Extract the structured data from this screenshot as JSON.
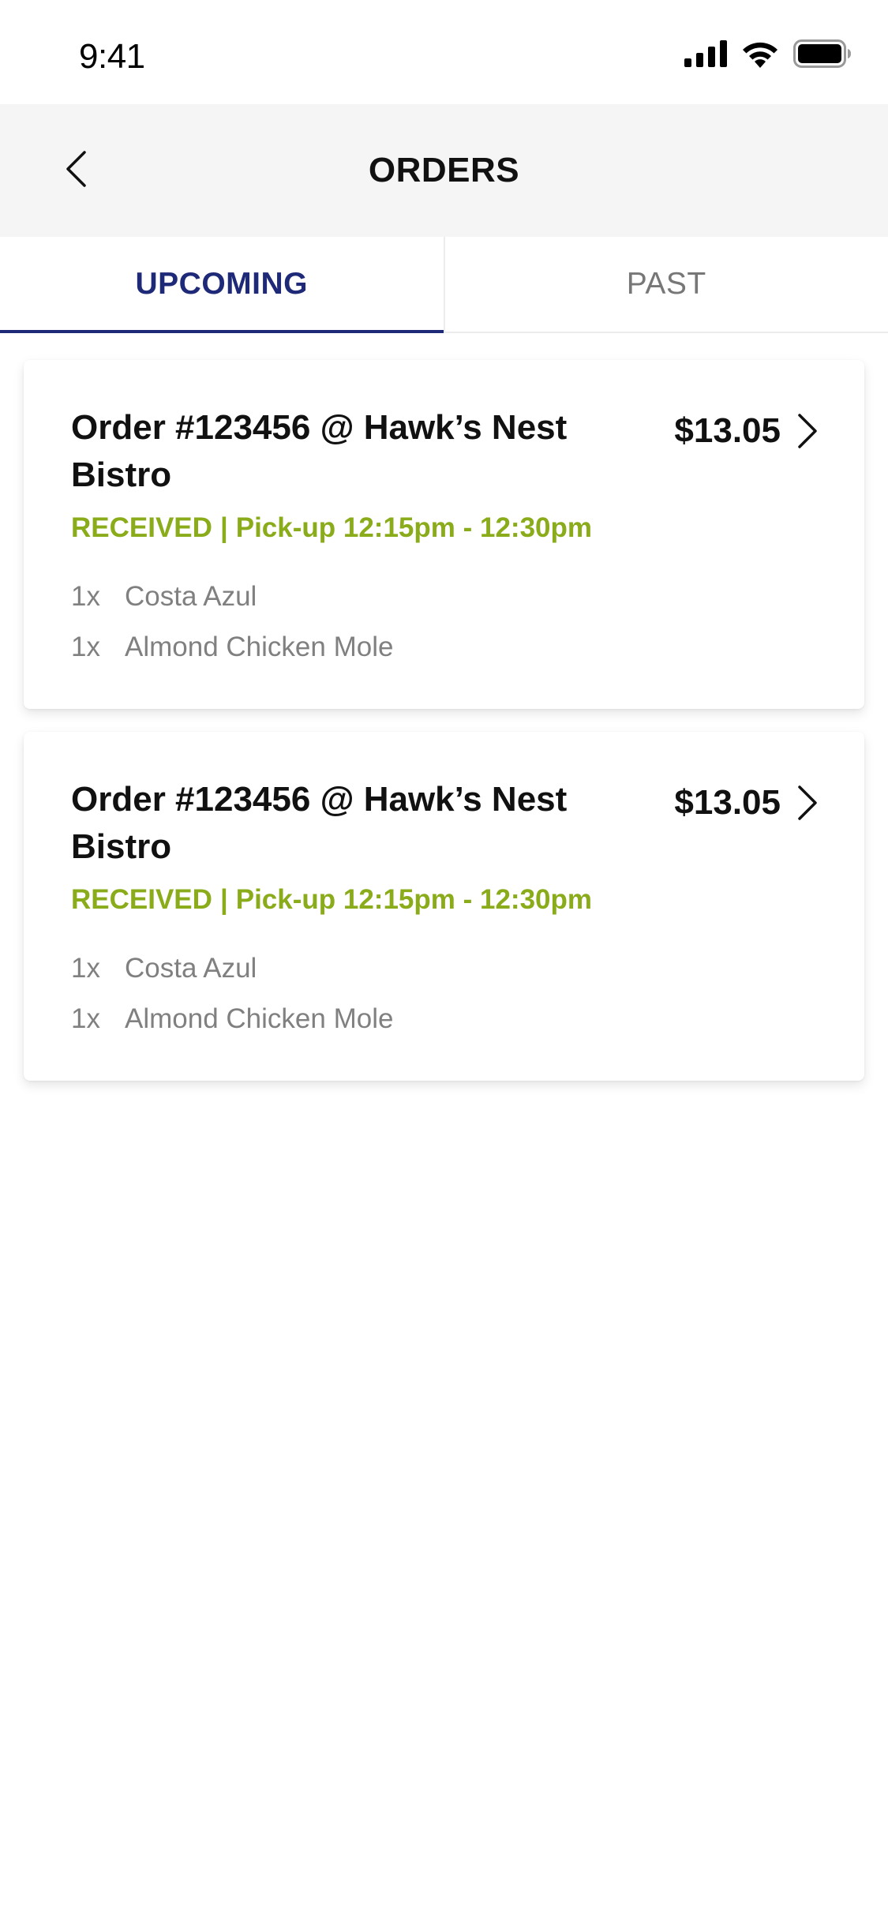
{
  "status_bar": {
    "time": "9:41",
    "icons": [
      "cellular-signal-icon",
      "wifi-icon",
      "battery-icon"
    ]
  },
  "header": {
    "title": "ORDERS",
    "back_icon": "chevron-left-icon"
  },
  "tabs": [
    {
      "label": "UPCOMING",
      "active": true
    },
    {
      "label": "PAST",
      "active": false
    }
  ],
  "orders": [
    {
      "title": "Order #123456 @ Hawk’s Nest Bistro",
      "price": "$13.05",
      "status": "RECEIVED",
      "separator": "|",
      "pickup": "Pick-up 12:15pm - 12:30pm",
      "items": [
        {
          "qty": "1x",
          "name": "Costa Azul"
        },
        {
          "qty": "1x",
          "name": "Almond Chicken Mole"
        }
      ]
    },
    {
      "title": "Order #123456 @ Hawk’s Nest Bistro",
      "price": "$13.05",
      "status": "RECEIVED",
      "separator": "|",
      "pickup": "Pick-up 12:15pm - 12:30pm",
      "items": [
        {
          "qty": "1x",
          "name": "Costa Azul"
        },
        {
          "qty": "1x",
          "name": "Almond Chicken Mole"
        }
      ]
    }
  ],
  "colors": {
    "accent": "#1e2a78",
    "status_green": "#8aab1a",
    "header_bg": "#f5f5f5",
    "muted_text": "#808080"
  }
}
